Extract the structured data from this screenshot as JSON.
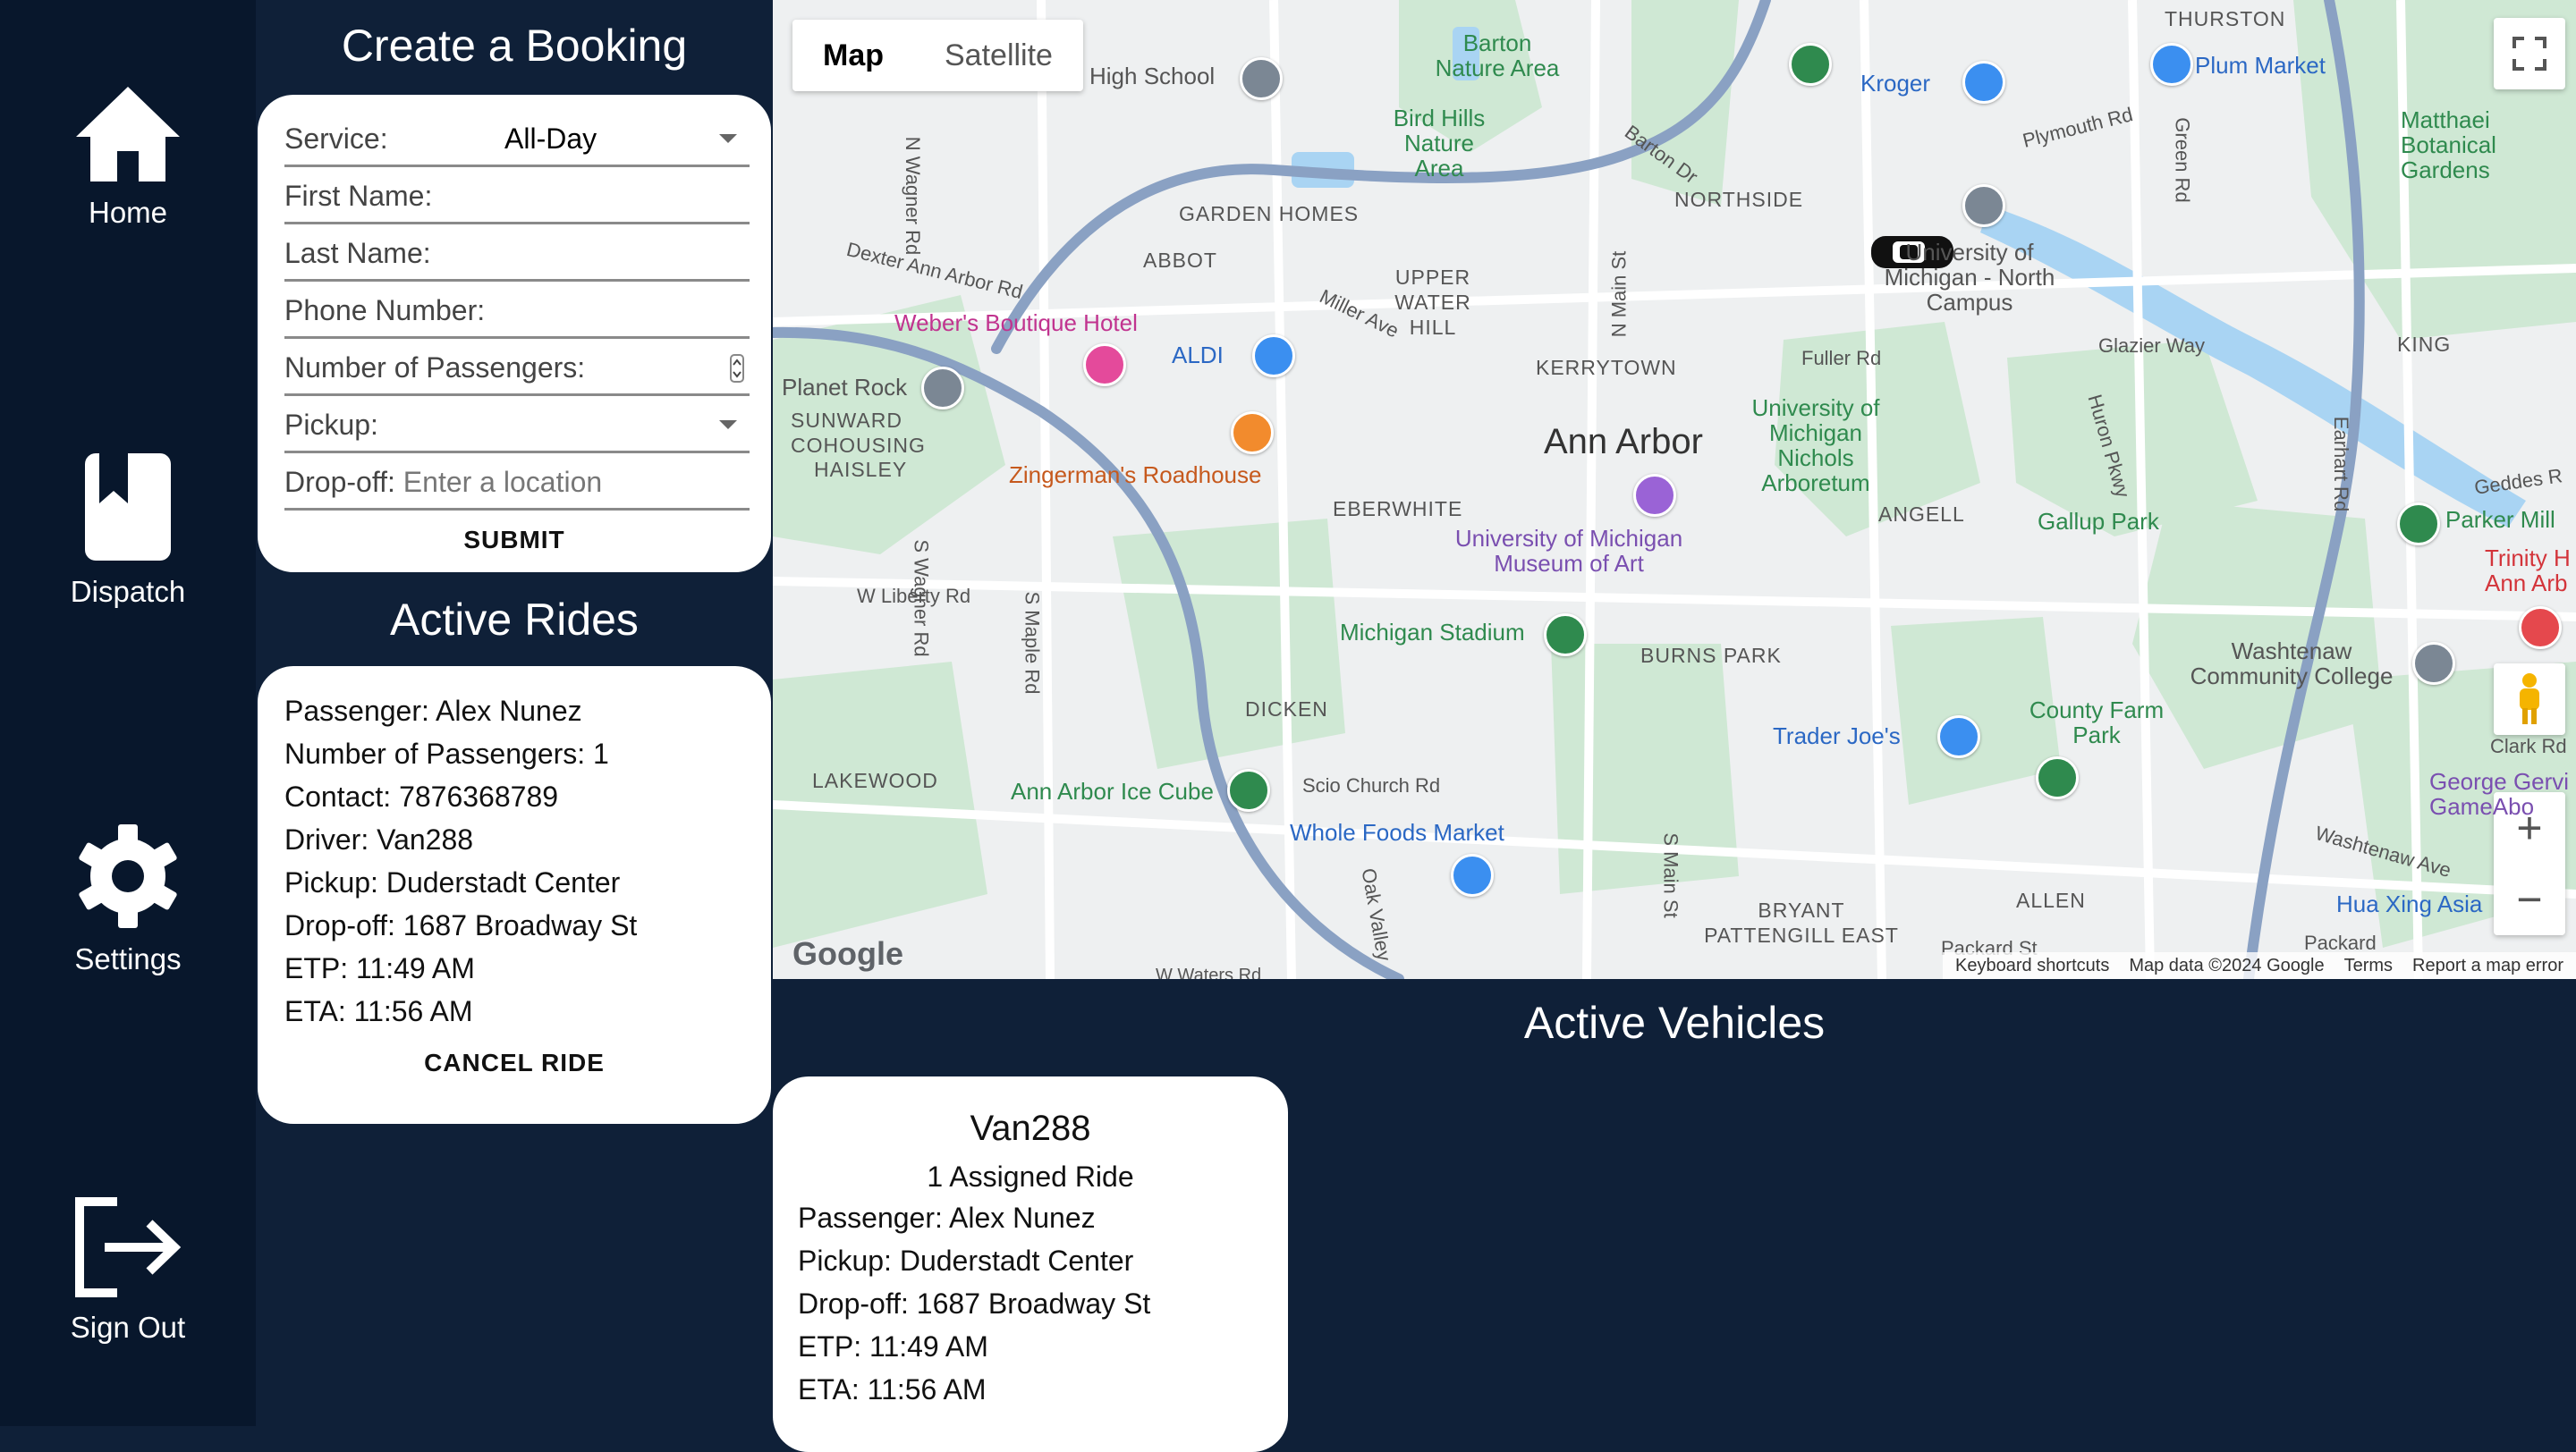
{
  "nav": {
    "home": "Home",
    "dispatch": "Dispatch",
    "settings": "Settings",
    "sign_out": "Sign Out"
  },
  "booking": {
    "title": "Create a Booking",
    "service_label": "Service:",
    "service_value": "All-Day",
    "first_name_label": "First Name:",
    "last_name_label": "Last Name:",
    "phone_label": "Phone Number:",
    "passengers_label": "Number of Passengers:",
    "pickup_label": "Pickup:",
    "dropoff_label": "Drop-off:",
    "dropoff_placeholder": "Enter a location",
    "submit": "SUBMIT"
  },
  "active_rides": {
    "title": "Active Rides",
    "ride": {
      "passenger": "Passenger: Alex Nunez",
      "count": "Number of Passengers: 1",
      "contact": "Contact: 7876368789",
      "driver": "Driver: Van288",
      "pickup": "Pickup: Duderstadt Center",
      "dropoff": "Drop-off: 1687 Broadway St",
      "etp": "ETP: 11:49 AM",
      "eta": "ETA: 11:56 AM",
      "cancel": "CANCEL RIDE"
    }
  },
  "map": {
    "tab_map": "Map",
    "tab_satellite": "Satellite",
    "labels": {
      "ann_arbor": "Ann Arbor",
      "kerrytown": "KERRYTOWN",
      "northside": "NORTHSIDE",
      "upper_water_hill": "UPPER WATER HILL",
      "garden_homes": "GARDEN HOMES",
      "abbot": "ABBOT",
      "eberwhite": "EBERWHITE",
      "burns_park": "BURNS PARK",
      "dicken": "DICKEN",
      "lakewood": "LAKEWOOD",
      "angell": "ANGELL",
      "king": "KING",
      "thurston": "THURSTON",
      "allen": "ALLEN",
      "bryant": "BRYANT PATTENGILL EAST",
      "sunward": "SUNWARD COHOUSING",
      "haisley": "HAISLEY",
      "barton": "Barton Nature Area",
      "bird_hills": "Bird Hills Nature Area",
      "high_school": "High School",
      "kroger": "Kroger",
      "plum_market": "Plum Market",
      "matthaei": "Matthaei Botanical Gardens",
      "um_north": "University of Michigan - North Campus",
      "um_arboretum": "University of Michigan Nichols Arboretum",
      "um_museum": "University of Michigan Museum of Art",
      "webers": "Weber's Boutique Hotel",
      "aldi": "ALDI",
      "planet_rock": "Planet Rock",
      "zingermans": "Zingerman's Roadhouse",
      "michigan_stadium": "Michigan Stadium",
      "gallup": "Gallup Park",
      "parker_mill": "Parker Mill",
      "trinity": "Trinity H Ann Arb",
      "washtenaw": "Washtenaw Community College",
      "county_farm": "County Farm Park",
      "trader_joes": "Trader Joe's",
      "ice_cube": "Ann Arbor Ice Cube",
      "whole_foods": "Whole Foods Market",
      "hua_xing": "Hua Xing Asia",
      "george_gervin": "George Gervi GameAbo",
      "scio_church": "Scio Church Rd",
      "w_liberty": "W Liberty Rd",
      "dexter": "Dexter Ann Arbor Rd",
      "fuller": "Fuller Rd",
      "plymouth": "Plymouth Rd",
      "glazier": "Glazier Way",
      "clark": "Clark Rd",
      "packard": "Packard St",
      "n_wagner": "N Wagner Rd",
      "s_wagner": "S Wagner Rd",
      "s_maple": "S Maple Rd",
      "n_main": "N Main St",
      "s_main": "S Main St",
      "miller": "Miller Ave",
      "huron_pkwy": "Huron Pkwy",
      "earhart": "Earhart Rd",
      "green_rd": "Green Rd",
      "barton_dr": "Barton Dr",
      "geddes": "Geddes R",
      "oak_valley": "Oak Valley",
      "washtenaw_ave": "Washtenaw Ave",
      "packard2": "Packard",
      "w_waters": "W Waters Rd"
    },
    "attribution": {
      "shortcuts": "Keyboard shortcuts",
      "data": "Map data ©2024 Google",
      "terms": "Terms",
      "report": "Report a map error"
    },
    "logo": "Google"
  },
  "active_vehicles": {
    "title": "Active Vehicles",
    "vehicle": {
      "name": "Van288",
      "assigned": "1 Assigned Ride",
      "passenger": "Passenger: Alex Nunez",
      "pickup": "Pickup: Duderstadt Center",
      "dropoff": "Drop-off: 1687 Broadway St",
      "etp": "ETP: 11:49 AM",
      "eta": "ETA: 11:56 AM"
    }
  },
  "colors": {
    "nav_bg": "#08172c",
    "panel_bg": "#0f2038",
    "card_bg": "#ffffff"
  }
}
